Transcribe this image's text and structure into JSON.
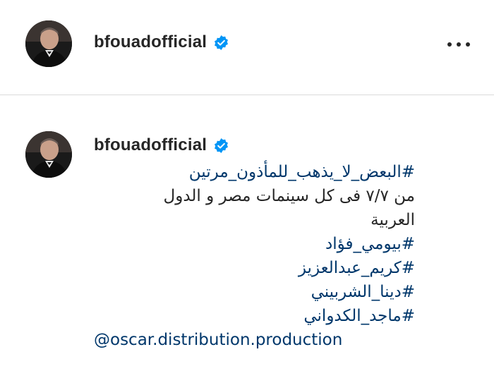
{
  "post_header": {
    "username": "bfouadofficial",
    "verified": true,
    "avatar_icon": "profile-photo",
    "more_icon": "more-options-icon"
  },
  "caption_comment": {
    "username": "bfouadofficial",
    "verified": true,
    "lines": [
      {
        "type": "hashtag",
        "text": "#البعض_لا_يذهب_للمأذون_مرتين"
      },
      {
        "type": "text",
        "text": "من ٧/٧ فى كل سينمات مصر و الدول"
      },
      {
        "type": "text",
        "text": "العربية"
      },
      {
        "type": "hashtag",
        "text": "#بيومي_فؤاد"
      },
      {
        "type": "hashtag",
        "text": "#كريم_عبدالعزيز"
      },
      {
        "type": "hashtag",
        "text": "#دينا_الشربيني"
      },
      {
        "type": "hashtag",
        "text": "#ماجد_الكدواني"
      },
      {
        "type": "mention",
        "text": "@oscar.distribution.production"
      }
    ]
  },
  "colors": {
    "text": "#262626",
    "link": "#00376b",
    "verified": "#0095f6",
    "divider": "#dbdbdb"
  }
}
